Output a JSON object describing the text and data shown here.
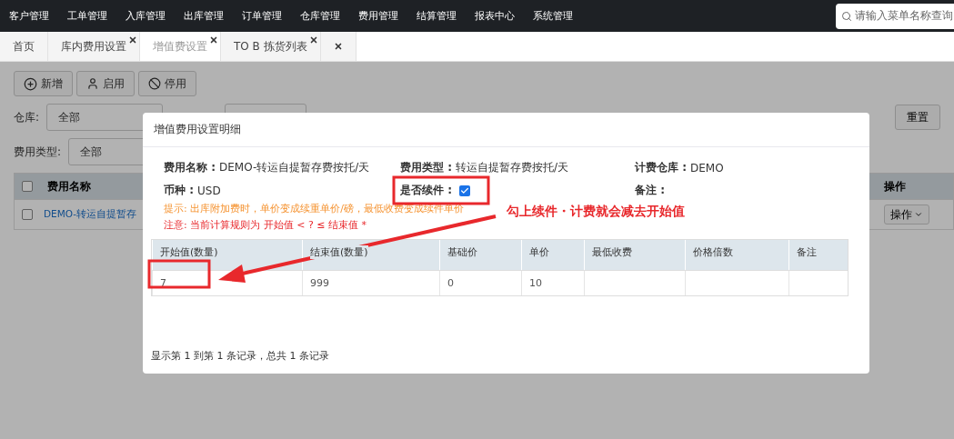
{
  "nav": {
    "items": [
      "客户管理",
      "工单管理",
      "入库管理",
      "出库管理",
      "订单管理",
      "仓库管理",
      "费用管理",
      "结算管理",
      "报表中心",
      "系统管理"
    ],
    "search": {
      "placeholder": "请输入菜单名称查询"
    }
  },
  "tabs": [
    {
      "label": "首页",
      "selected": false,
      "closable": false
    },
    {
      "label": "库内费用设置",
      "selected": false,
      "closable": true
    },
    {
      "label": "增值费设置",
      "selected": true,
      "closable": true
    },
    {
      "label": "TO B 拣货列表",
      "selected": false,
      "closable": true
    }
  ],
  "toolbar": [
    {
      "label": "新增",
      "kind": "add"
    },
    {
      "label": "启用",
      "kind": "enable"
    },
    {
      "label": "停用",
      "kind": "disable"
    }
  ],
  "filters": {
    "warehouse": {
      "label": "仓库:",
      "value": "全部"
    },
    "fee_type": {
      "label": "费用类型:",
      "value": "全部"
    },
    "reset": "重置"
  },
  "table": {
    "columns": [
      "费用名称",
      "操作"
    ],
    "rows": [
      {
        "name": "DEMO-转运自提暂存",
        "action": "操作",
        "checked": false
      }
    ],
    "header_checked": false
  },
  "modal": {
    "title": "增值费用设置明细",
    "fields": [
      {
        "label": "费用名称 :",
        "value": "DEMO-转运自提暂存费按托/天"
      },
      {
        "label": "费用类型 :",
        "value": "转运自提暂存费按托/天"
      },
      {
        "label": "计费仓库 :",
        "value": "DEMO"
      },
      {
        "label": "币种 :",
        "value": "USD"
      },
      {
        "label": "是否续件 :",
        "kind": "checkbox",
        "checked": true
      },
      {
        "label": "备注 :"
      }
    ],
    "tip": "提示:  出库附加费时，单价变成续重单价/磅，最低收费变成续件单价",
    "note": "注意:  当前计算规则为 开始值 < ? ≤ 结束值 *",
    "columns": [
      "开始值(数量)",
      "结束值(数量)",
      "基础价",
      "单价",
      "最低收费",
      "价格倍数",
      "备注"
    ],
    "rows": [
      [
        "7",
        "999",
        "0",
        "10",
        "",
        "",
        ""
      ]
    ],
    "footer": "显示第 1 到第 1 条记录，总共 1 条记录"
  },
  "annotation": {
    "text": "勾上续件・计费就会减去开始值"
  }
}
